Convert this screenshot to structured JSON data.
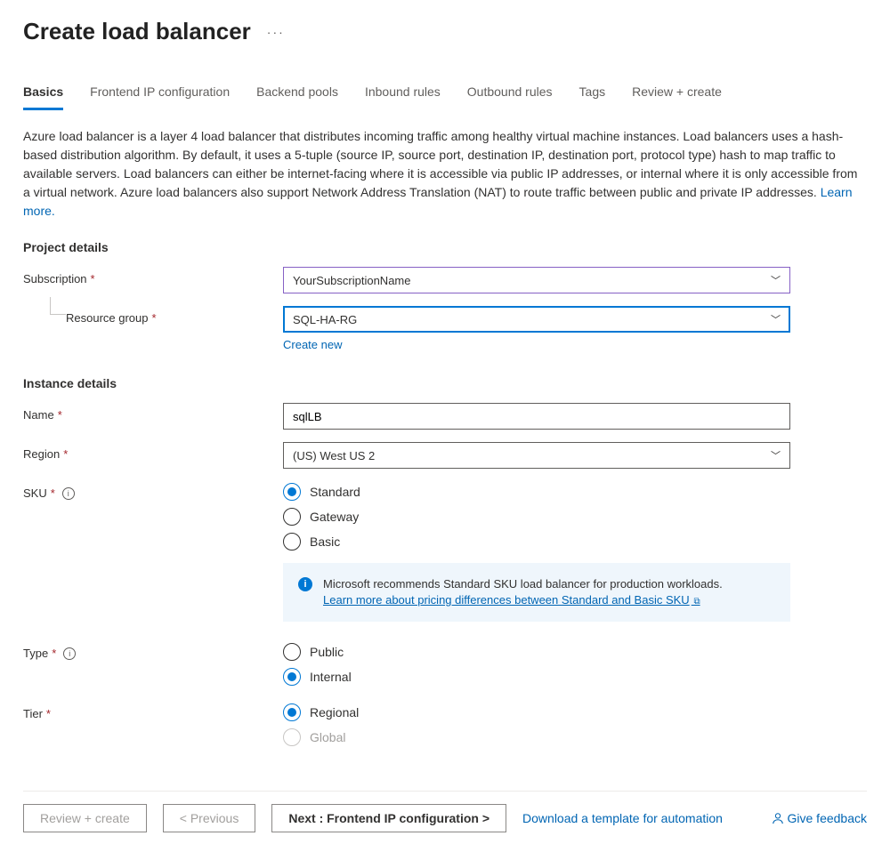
{
  "header": {
    "title": "Create load balancer",
    "more_label": "···"
  },
  "tabs": [
    {
      "label": "Basics",
      "active": true
    },
    {
      "label": "Frontend IP configuration",
      "active": false
    },
    {
      "label": "Backend pools",
      "active": false
    },
    {
      "label": "Inbound rules",
      "active": false
    },
    {
      "label": "Outbound rules",
      "active": false
    },
    {
      "label": "Tags",
      "active": false
    },
    {
      "label": "Review + create",
      "active": false
    }
  ],
  "description": {
    "text": "Azure load balancer is a layer 4 load balancer that distributes incoming traffic among healthy virtual machine instances. Load balancers uses a hash-based distribution algorithm. By default, it uses a 5-tuple (source IP, source port, destination IP, destination port, protocol type) hash to map traffic to available servers. Load balancers can either be internet-facing where it is accessible via public IP addresses, or internal where it is only accessible from a virtual network. Azure load balancers also support Network Address Translation (NAT) to route traffic between public and private IP addresses.  ",
    "learn_more": "Learn more."
  },
  "sections": {
    "project": {
      "title": "Project details",
      "subscription": {
        "label": "Subscription",
        "value": "YourSubscriptionName"
      },
      "resource_group": {
        "label": "Resource group",
        "value": "SQL-HA-RG",
        "create_new": "Create new"
      }
    },
    "instance": {
      "title": "Instance details",
      "name": {
        "label": "Name",
        "value": "sqlLB"
      },
      "region": {
        "label": "Region",
        "value": "(US) West US 2"
      },
      "sku": {
        "label": "SKU",
        "options": [
          "Standard",
          "Gateway",
          "Basic"
        ],
        "selected": "Standard",
        "info": {
          "text": "Microsoft recommends Standard SKU load balancer for production workloads.",
          "link": "Learn more about pricing differences between Standard and Basic SKU"
        }
      },
      "type": {
        "label": "Type",
        "options": [
          "Public",
          "Internal"
        ],
        "selected": "Internal"
      },
      "tier": {
        "label": "Tier",
        "options": [
          {
            "label": "Regional",
            "disabled": false
          },
          {
            "label": "Global",
            "disabled": true
          }
        ],
        "selected": "Regional"
      }
    }
  },
  "footer": {
    "review": "Review + create",
    "previous": "< Previous",
    "next": "Next : Frontend IP configuration >",
    "download": "Download a template for automation",
    "feedback": "Give feedback"
  }
}
